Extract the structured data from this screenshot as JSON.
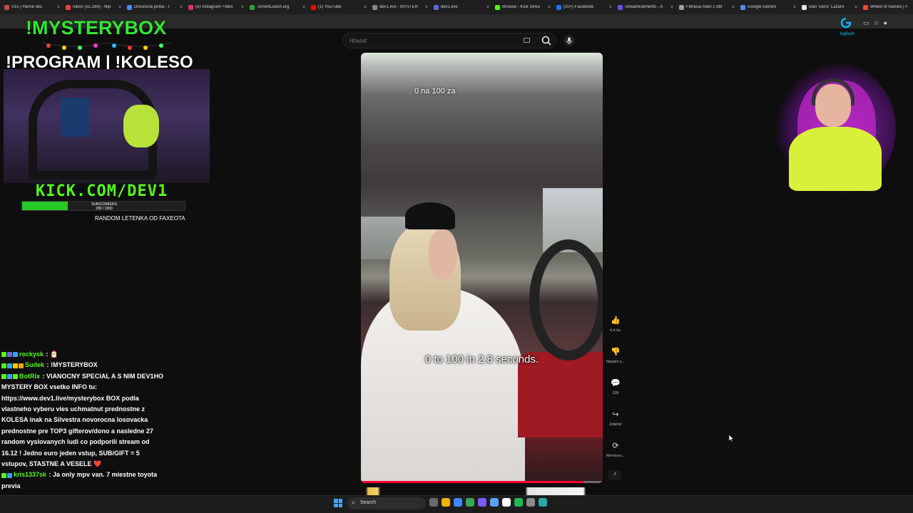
{
  "browser": {
    "tabs": [
      {
        "title": "V15 | Herné oku",
        "color": "#d14848"
      },
      {
        "title": "Inbox (52,289) - filip",
        "color": "#ea4335"
      },
      {
        "title": "Doručená pošta - I",
        "color": "#4a8cf0"
      },
      {
        "title": "(5) Instagram • Mes",
        "color": "#e1306c"
      },
      {
        "title": "TorrentLeech.org",
        "color": "#2aa834"
      },
      {
        "title": "(1) YouTube",
        "color": "#ff0000"
      },
      {
        "title": "dev1.live - MYSTER",
        "color": "#8a8a8a"
      },
      {
        "title": "dev1.live",
        "color": "#5a6bd8"
      },
      {
        "title": "Browse - Kick Strea",
        "color": "#53fc18"
      },
      {
        "title": "(20+) Facebook",
        "color": "#1877f2"
      },
      {
        "title": "StreamElements - A",
        "color": "#6a4df0"
      },
      {
        "title": "Filtrácia mien z obr",
        "color": "#9aa0a6"
      },
      {
        "title": "Google Gemini",
        "color": "#4f8df5"
      },
      {
        "title": "Ivan 'Dev1' Lazaro",
        "color": "#e5e5e5"
      },
      {
        "title": "Wheel of Names | F",
        "color": "#f44336"
      }
    ],
    "tab_close": "×"
  },
  "youtube": {
    "search_placeholder": "Hľadať",
    "search_icon": "search-icon",
    "mic_icon": "mic-icon",
    "brand": "logitech",
    "short": {
      "caption_top": "0 na 100 za",
      "caption_main": "0 to 100 in 2.8 seconds.",
      "progress": 0.92
    },
    "actions": [
      {
        "icon": "like-icon",
        "glyph": "👍",
        "label": "4,4 tis."
      },
      {
        "icon": "dislike-icon",
        "glyph": "👎",
        "label": "Nepáči s..."
      },
      {
        "icon": "comment-icon",
        "glyph": "💬",
        "label": "109"
      },
      {
        "icon": "share-icon",
        "glyph": "↪",
        "label": "Zdieľať"
      },
      {
        "icon": "remix-icon",
        "glyph": "⟳",
        "label": "Remixov..."
      }
    ]
  },
  "overlay": {
    "title1": "!MYSTERYBOX",
    "title2": "!PROGRAM | !KOLESO",
    "kick": "KICK.COM/DEV1",
    "subs_label": "SUBSCRIBERS",
    "subs_count": "280 / 1000",
    "subs_progress": 0.28,
    "ticker": "RANDOM LETENKA OD FAXEOTA"
  },
  "chat": {
    "messages": [
      {
        "user": "rockysk",
        "color": "#53fc18",
        "text": ": 🎅",
        "badges": [
          "#53fc18",
          "#7a5cff",
          "#3aa0ff"
        ]
      },
      {
        "user": "Sudek",
        "color": "#53fc18",
        "text": ": !MYSTERYBOX",
        "badges": [
          "#53fc18",
          "#3aa0ff",
          "#ffcc00",
          "#ffa500"
        ]
      },
      {
        "user": "BotRix",
        "color": "#53fc18",
        "text": ": VIANOCNY SPECIAL A S NIM DEV1HO MYSTERY BOX vsetko INFO tu: https://www.dev1.live/mysterybox BOX podla vlastneho vyberu vies uchmatnut prednostne z KOLESA inak na Silvestra novorocna losovacka prednostne pre TOP3 gifterov/dono a nasledne 27 random vyslovanych ludi co podporili stream od 16.12 ! Jedno euro jeden vstup, SUB/GIFT = 5 vstupov, STASTNE A VESELE ❤️",
        "badges": [
          "#53fc18",
          "#3aa0ff",
          "#53fc18"
        ]
      },
      {
        "user": "kris1337sk",
        "color": "#53fc18",
        "text": ": Ja only mpv van. 7 miestne toyota previa",
        "badges": [
          "#53fc18",
          "#3aa0ff"
        ]
      }
    ]
  },
  "taskbar": {
    "search_label": "Search",
    "icons": [
      "#6b6b6b",
      "#f0b400",
      "#4285f4",
      "#34a853",
      "#7b5cff",
      "#5aa0ff",
      "#ffffff",
      "#1db954",
      "#8a8a8a",
      "#2aa6a6"
    ]
  }
}
